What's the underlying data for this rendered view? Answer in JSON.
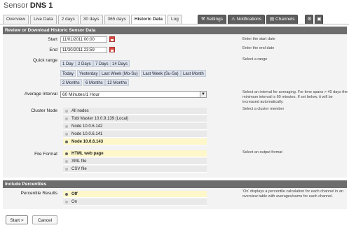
{
  "page": {
    "title_prefix": "Sensor",
    "title_name": "DNS 1"
  },
  "tabs": [
    {
      "label": "Overview"
    },
    {
      "label": "Live Data"
    },
    {
      "label": "2 days"
    },
    {
      "label": "30 days"
    },
    {
      "label": "365 days"
    },
    {
      "label": "Historic Data",
      "active": true
    },
    {
      "label": "Log"
    }
  ],
  "action_tabs": {
    "settings": "Settings",
    "notifications": "Notifications",
    "channels": "Channels"
  },
  "section1": {
    "title": "Review or Download Historic Sensor Data"
  },
  "start": {
    "label": "Start",
    "value": "11/01/2011 00:00",
    "help": "Enter the start date"
  },
  "end": {
    "label": "End",
    "value": "11/30/2011 23:59",
    "help": "Enter the end date"
  },
  "quick_range": {
    "label": "Quick range",
    "help": "Select a range",
    "row1": [
      "1 Day",
      "2 Days",
      "7 Days",
      "14 Days"
    ],
    "row2": [
      "Today",
      "Yesterday",
      "Last Week (Mo-Su)",
      "Last Week (Su-Sa)",
      "Last Month"
    ],
    "row3": [
      "2 Months",
      "6 Months",
      "12 Months"
    ]
  },
  "average_interval": {
    "label": "Average Interval",
    "value": "60 Minutes/1 Hour",
    "help": "Select an interval for averaging. For time spans > 40 days the minimum interval is 60 minutes. If set below, it will be increased automatically."
  },
  "cluster_node": {
    "label": "Cluster Node",
    "help": "Select a cluster member",
    "options": [
      "All nodes",
      "Tobi Master 10.0.9.139 (Local)",
      "Node 10.0.6.142",
      "Node 10.0.6.141",
      "Node 10.0.6.143"
    ],
    "selected": "Node 10.0.6.143"
  },
  "file_format": {
    "label": "File Format",
    "help": "Select an output format",
    "options": [
      "HTML web page",
      "XML file",
      "CSV file"
    ],
    "selected": "HTML web page"
  },
  "section2": {
    "title": "Include Percentiles"
  },
  "percentile": {
    "label": "Percentile Results",
    "help": "'On' displays a percentile calculation for each channel in an overview table with averages/sums for each channel.",
    "options": [
      "Off",
      "On"
    ],
    "selected": "Off"
  },
  "buttons": {
    "start": "Start >",
    "cancel": "Cancel"
  },
  "colors": {
    "header_bg": "#6d6d6d",
    "selected_row": "#fdf7c9",
    "calendar_icon": "#d74a3e"
  }
}
